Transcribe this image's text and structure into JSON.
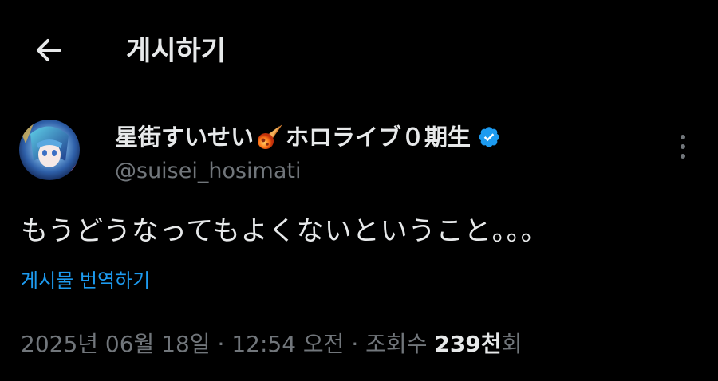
{
  "colors": {
    "background": "#000000",
    "primary_text": "#e7e9ea",
    "secondary_text": "#71767b",
    "link": "#1d9bf0",
    "verified_badge": "#1d9bf0",
    "divider": "#2f3336"
  },
  "header": {
    "back_icon": "arrow-left-icon",
    "title": "게시하기"
  },
  "author": {
    "avatar_icon": "avatar-image",
    "name_part1": "星街すいせい",
    "emoji_icon": "comet-icon",
    "name_part2": "ホロライブ０期生",
    "verified_icon": "verified-badge-icon",
    "handle": "@suisei_hosimati"
  },
  "more_icon": "more-vertical-icon",
  "post": {
    "text": "もうどうなってもよくないということ。。。",
    "translate_label": "게시물 번역하기"
  },
  "meta": {
    "date": "2025년 06월 18일",
    "separator": "·",
    "time": "12:54 오전",
    "views_label": "조회수",
    "views_count": "239천",
    "views_suffix": "회"
  }
}
